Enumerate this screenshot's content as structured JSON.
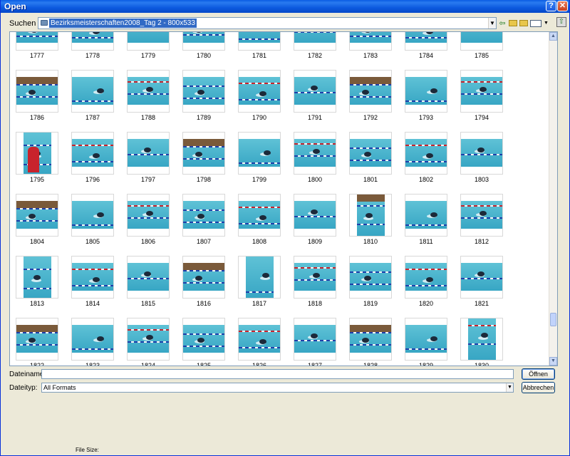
{
  "window": {
    "title": "Open"
  },
  "titlebar": {
    "help_icon": "?",
    "close_icon": "✕"
  },
  "look_in": {
    "label": "Suchen in:",
    "value": "Bezirksmeisterschaften2008_Tag 2 - 800x533"
  },
  "toolbar": {
    "back_icon": "back-arrow-icon",
    "up_icon": "up-folder-icon",
    "new_folder_icon": "new-folder-icon",
    "views_icon": "views-menu-icon"
  },
  "files": {
    "items": [
      "1777",
      "1778",
      "1779",
      "1780",
      "1781",
      "1782",
      "1783",
      "1784",
      "1785",
      "1786",
      "1787",
      "1788",
      "1789",
      "1790",
      "1791",
      "1792",
      "1793",
      "1794",
      "1795",
      "1796",
      "1797",
      "1798",
      "1799",
      "1800",
      "1801",
      "1802",
      "1803",
      "1804",
      "1805",
      "1806",
      "1807",
      "1808",
      "1809",
      "1810",
      "1811",
      "1812",
      "1813",
      "1814",
      "1815",
      "1816",
      "1817",
      "1818",
      "1819",
      "1820",
      "1821",
      "1822",
      "1823",
      "1824",
      "1825",
      "1826",
      "1827",
      "1828",
      "1829",
      "1830"
    ]
  },
  "filename": {
    "label": "Dateiname:",
    "value": ""
  },
  "filetype": {
    "label": "Dateityp:",
    "value": "All Formats"
  },
  "buttons": {
    "open_label": "Öffnen",
    "cancel_label": "Abbrechen"
  },
  "status": {
    "file_size_label": "File Size:"
  },
  "colors": {
    "titlebar": "#0a5ce3",
    "dialog_bg": "#ece9d8",
    "selection": "#316ac5",
    "pool": "#3aa8c6"
  }
}
